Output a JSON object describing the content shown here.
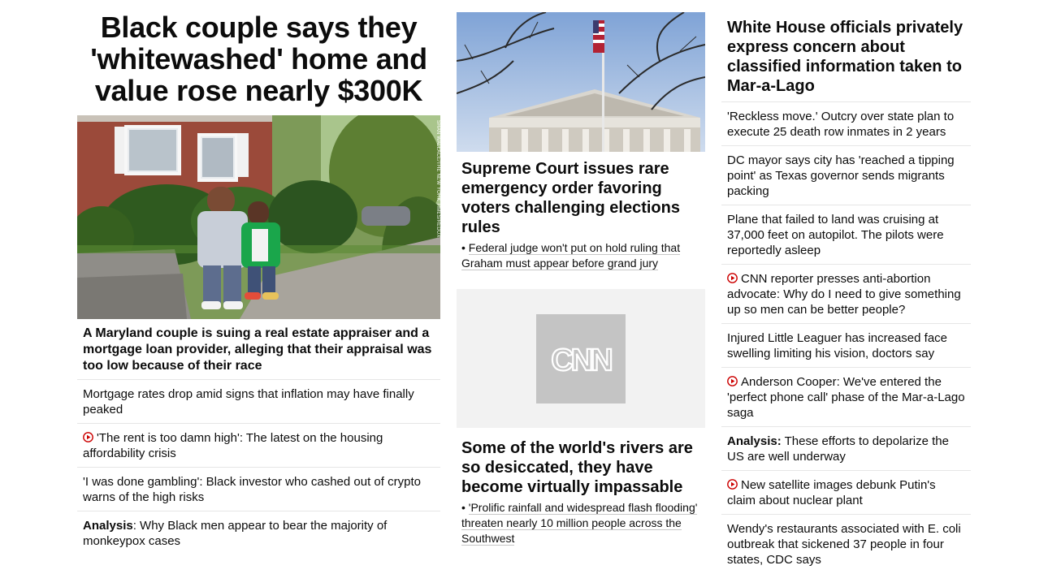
{
  "col1": {
    "headline": "Black couple says they 'whitewashed' home and value rose nearly $300K",
    "photo_credit": "SHAN WALLACE/THE NEW YORK TIMES/REDUX",
    "caption": "A Maryland couple is suing a real estate appraiser and a mortgage loan provider, alleging that their appraisal was too low because of their race",
    "stories": [
      {
        "label": "",
        "text": "Mortgage rates drop amid signs that inflation may have finally peaked",
        "video": false
      },
      {
        "label": "",
        "text": "'The rent is too damn high': The latest on the housing affordability crisis",
        "video": true
      },
      {
        "label": "",
        "text": "'I was done gambling': Black investor who cashed out of crypto warns of the high risks",
        "video": false
      },
      {
        "label": "Analysis",
        "text": ": Why Black men appear to bear the majority of monkeypox cases",
        "video": false
      }
    ]
  },
  "col2": {
    "story1": {
      "headline": "Supreme Court issues rare emergency order favoring voters challenging elections rules",
      "bullet": "Federal judge won't put on hold ruling that Graham must appear before grand jury"
    },
    "story2": {
      "logo_text": "CNN",
      "headline": "Some of the world's rivers are so desiccated, they have become virtually impassable",
      "bullet": "'Prolific rainfall and widespread flash flooding' threaten nearly 10 million people across the Southwest"
    }
  },
  "col3": {
    "headline": "White House officials privately express concern about classified information taken to Mar-a-Lago",
    "stories": [
      {
        "label": "",
        "text": "'Reckless move.' Outcry over state plan to execute 25 death row inmates in 2 years",
        "video": false
      },
      {
        "label": "",
        "text": "DC mayor says city has 'reached a tipping point' as Texas governor sends migrants packing",
        "video": false
      },
      {
        "label": "",
        "text": "Plane that failed to land was cruising at 37,000 feet on autopilot. The pilots were reportedly asleep",
        "video": false
      },
      {
        "label": "",
        "text": "CNN reporter presses anti-abortion advocate: Why do I need to give something up so men can be better people?",
        "video": true
      },
      {
        "label": "",
        "text": "Injured Little Leaguer has increased face swelling limiting his vision, doctors say",
        "video": false
      },
      {
        "label": "",
        "text": "Anderson Cooper: We've entered the 'perfect phone call' phase of the Mar-a-Lago saga",
        "video": true
      },
      {
        "label": "Analysis:",
        "text": " These efforts to depolarize the US are well underway",
        "video": false
      },
      {
        "label": "",
        "text": "New satellite images debunk Putin's claim about nuclear plant",
        "video": true
      },
      {
        "label": "",
        "text": "Wendy's restaurants associated with E. coli outbreak that sickened 37 people in four states, CDC says",
        "video": false
      }
    ]
  },
  "colors": {
    "text": "#0c0c0c",
    "divider": "#e6e6e6",
    "video_red": "#cc0000",
    "placeholder_bg": "#f2f2f2",
    "logo_tile": "#c4c4c4"
  },
  "icons": {
    "video": "play-circle-icon",
    "logo": "cnn-logo"
  }
}
